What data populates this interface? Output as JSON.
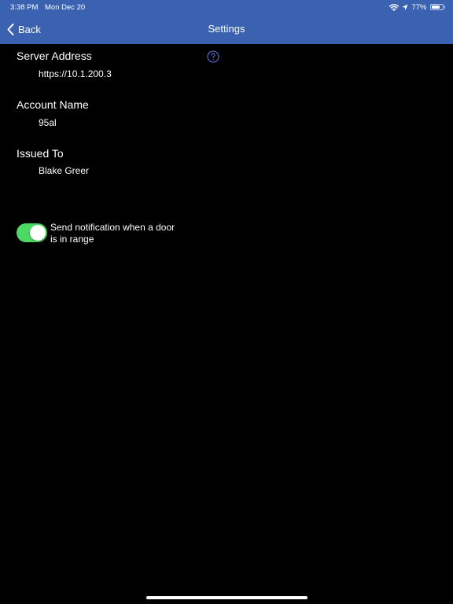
{
  "status_bar": {
    "time": "3:38 PM",
    "date": "Mon Dec 20",
    "battery_percent": "77%",
    "battery_level": 0.77,
    "icons": [
      "wifi-icon",
      "location-icon",
      "battery-icon"
    ]
  },
  "nav": {
    "back_label": "Back",
    "title": "Settings",
    "bar_color": "#3a62b0"
  },
  "help": {
    "icon": "question-circle-icon",
    "color": "#5b6fd6"
  },
  "fields": {
    "server_address": {
      "label": "Server Address",
      "value": "https://10.1.200.3"
    },
    "account_name": {
      "label": "Account Name",
      "value": "95al"
    },
    "issued_to": {
      "label": "Issued To",
      "value": "Blake Greer"
    }
  },
  "notification_toggle": {
    "label": "Send notification when a door is in range",
    "on": true,
    "on_color": "#4cd964"
  }
}
